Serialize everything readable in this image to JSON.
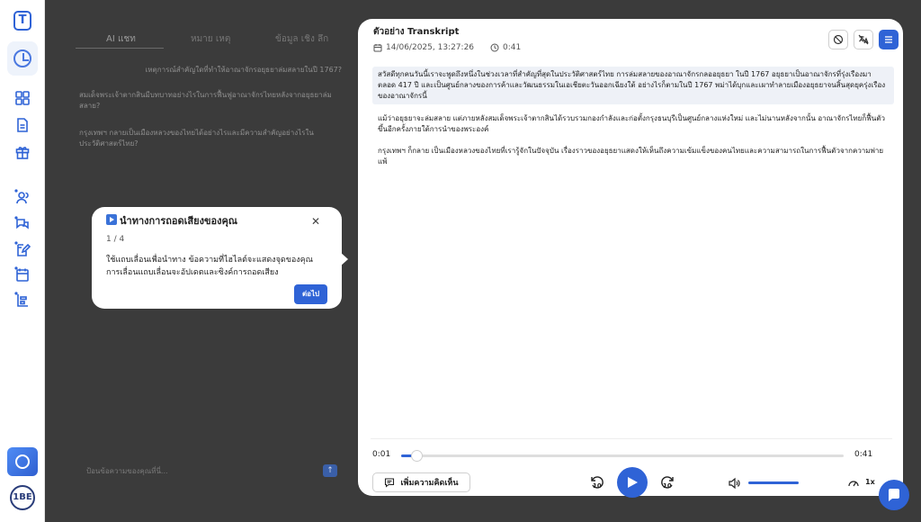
{
  "chat": {
    "tabs": [
      "AI แชท",
      "หมาย เหตุ",
      "ข้อมูล เชิง ลึก"
    ],
    "questions": [
      "เหตุการณ์สำคัญใดที่ทำให้อาณาจักรอยุธยาล่มสลายในปี 1767?",
      "สมเด็จพระเจ้าตากสินมีบทบาทอย่างไรในการฟื้นฟูอาณาจักรไทยหลังจากอยุธยาล่มสลาย?",
      "กรุงเทพฯ กลายเป็นเมืองหลวงของไทยได้อย่างไรและมีความสำคัญอย่างไรในประวัติศาสตร์ไทย?"
    ],
    "input_placeholder": "ป้อนข้อความของคุณที่นี่..."
  },
  "transcript": {
    "title": "ตัวอย่าง Transkript",
    "date": "14/06/2025, 13:27:26",
    "duration": "0:41",
    "paragraphs": [
      "สวัสดีทุกคนวันนี้เราจะพูดถึงหนึ่งในช่วงเวลาที่สำคัญที่สุดในประวัติศาสตร์ไทย การล่มสลายของอาณาจักรกลออยุธยา ในปี 1767 อยุธยาเป็นอาณาจักรที่รุ่งเรืองมาตลอด 417 ปี และเป็นศูนย์กลางของการค้าและวัฒนธรรมในเอเชียตะวันออกเฉียงใต้ อย่างไรก็ตามในปี 1767 พม่าได้บุกและเผาทำลายเมืองอยุธยาจนสิ้นสุดยุครุ่งเรืองของอาณาจักรนี้",
      "แม้ว่าอยุธยาจะล่มสลาย แต่ภายหลังสมเด็จพระเจ้าตากสินได้รวบรวมกองกำลังและก่อตั้งกรุงธนบุรีเป็นศูนย์กลางแห่งใหม่ และไม่นานหลังจากนั้น อาณาจักรไทยก็ฟื้นตัวขึ้นอีกครั้งภายใต้การนำของพระองค์",
      "กรุงเทพฯ ก็กลาย เป็นเมืองหลวงของไทยที่เรารู้จักในปัจจุบัน เรื่องราวของอยุธยาแสดงให้เห็นถึงความเข้มแข็งของคนไทยและความสามารถในการฟื้นตัวจากความพ่ายแพ้"
    ]
  },
  "player": {
    "current_time": "0:01",
    "total_time": "0:41",
    "progress": 0.035,
    "comment_label": "เพิ่มความคิดเห็น",
    "skip_back_seconds": "10",
    "skip_forward_seconds": "10",
    "volume": 1.0,
    "speed": "1x"
  },
  "tour": {
    "title": "นำทางการถอดเสียงของคุณ",
    "step": "1 / 4",
    "body": "ใช้แถบเลื่อนเพื่อนำทาง ข้อความที่ไฮไลต์จะแสดงจุดของคุณ การเลื่อนแถบเลื่อนจะอัปเดตและซิงค์การถอดเสียง",
    "next_label": "ต่อไป",
    "close_symbol": "✕"
  },
  "rail": {
    "logo_letter": "T",
    "avatar_text": "1BE"
  },
  "colors": {
    "accent": "#2f63d6",
    "highlight": "#eef1f7",
    "overlay": "#3b3b3b"
  }
}
